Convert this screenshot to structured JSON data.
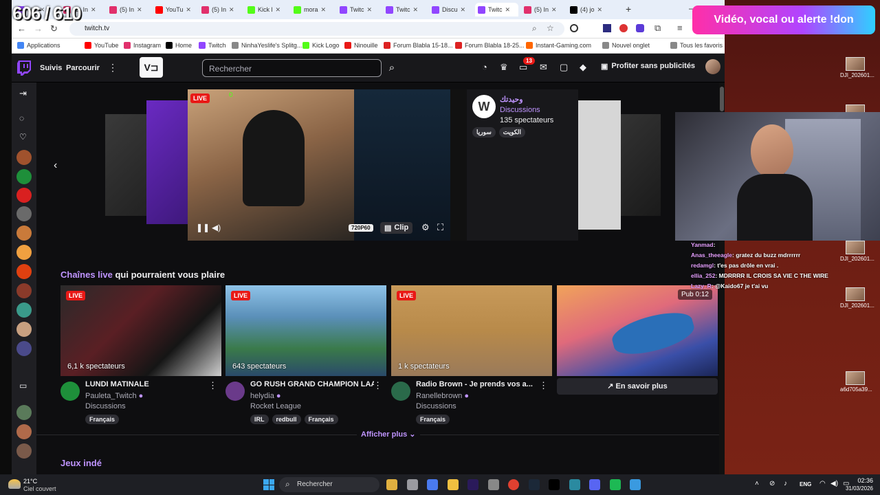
{
  "overlay": {
    "counter": "606 / 610",
    "donation": "Vidéo, vocal ou alerte !don",
    "chat": [
      {
        "user": "Yanmad",
        "text": ""
      },
      {
        "user": "Anas_theeagle",
        "text": "gratez du buzz mdrrrrrr"
      },
      {
        "user": "redamgl",
        "text": "t'es pas drôle en vrai ."
      },
      {
        "user": "ellia_252",
        "text": "MDRRRR IL CROIS SA VIE C THE WIRE"
      },
      {
        "user": "Lazy_R",
        "text": "@Kaido67 je t'ai vu"
      }
    ],
    "desktop_files": [
      "DJI_202601...",
      "DJI_202601...",
      "DJI_202601...",
      "DJI_202601...",
      "a6d705a39..."
    ]
  },
  "browser": {
    "tabs": [
      {
        "label": "Nin",
        "color": "#9146ff"
      },
      {
        "label": "(5) In",
        "color": "#e1306c"
      },
      {
        "label": "(5) In",
        "color": "#e1306c"
      },
      {
        "label": "YouTu",
        "color": "#ff0000"
      },
      {
        "label": "(5) In",
        "color": "#e1306c"
      },
      {
        "label": "Kick l",
        "color": "#53fc18"
      },
      {
        "label": "mora",
        "color": "#53fc18"
      },
      {
        "label": "Twitc",
        "color": "#9146ff"
      },
      {
        "label": "Twitc",
        "color": "#9146ff"
      },
      {
        "label": "Discu",
        "color": "#9146ff"
      },
      {
        "label": "Twitc",
        "color": "#9146ff"
      },
      {
        "label": "(5) In",
        "color": "#e1306c"
      },
      {
        "label": "(4) jo",
        "color": "#000000"
      }
    ],
    "url": "twitch.tv",
    "bookmarks": [
      {
        "label": "Applications",
        "color": "#4285f4"
      },
      {
        "label": "YouTube",
        "color": "#ff0000"
      },
      {
        "label": "Instagram",
        "color": "#e1306c"
      },
      {
        "label": "Home",
        "color": "#000000"
      },
      {
        "label": "Twitch",
        "color": "#9146ff"
      },
      {
        "label": "NinhaYeslife's Splitg...",
        "color": "#888888"
      },
      {
        "label": "Kick Logo",
        "color": "#53fc18"
      },
      {
        "label": "Ninouille",
        "color": "#e91916"
      },
      {
        "label": "Forum Blabla 15-18...",
        "color": "#d22"
      },
      {
        "label": "Forum Blabla 18-25...",
        "color": "#d22"
      },
      {
        "label": "Instant-Gaming.com",
        "color": "#f60"
      },
      {
        "label": "Nouvel onglet",
        "color": "#888"
      },
      {
        "label": "Tous les favoris",
        "color": "#888"
      }
    ]
  },
  "twitch": {
    "nav": {
      "following": "Suivis",
      "browse": "Parcourir",
      "search_placeholder": "Rechercher",
      "notif_count": "13",
      "prime": "Profiter sans publicités"
    },
    "featured": {
      "live": "LIVE",
      "viewers_icon_count": "0",
      "channel": "وحيدتك",
      "category": "Discussions",
      "viewers": "135 spectateurs",
      "tags": [
        "سوريا",
        "الكويت"
      ],
      "quality": "720P60",
      "clip": "Clip"
    },
    "section": {
      "highlight": "Chaînes live",
      "rest": " qui pourraient vous plaire"
    },
    "cards": [
      {
        "live": "LIVE",
        "viewers": "6,1 k spectateurs",
        "title": "LUNDI MATINALE",
        "channel": "Pauleta_Twitch",
        "category": "Discussions",
        "tags": [
          "Français"
        ]
      },
      {
        "live": "LIVE",
        "viewers": "643 spectateurs",
        "title": "GO RUSH GRAND CHAMPION LAA...",
        "channel": "helydia",
        "category": "Rocket League",
        "tags": [
          "IRL",
          "redbull",
          "Français"
        ]
      },
      {
        "live": "LIVE",
        "viewers": "1 k spectateurs",
        "title": "Radio Brown - Je prends vos a...",
        "channel": "Ranellebrown",
        "category": "Discussions",
        "tags": [
          "Français"
        ]
      }
    ],
    "ad": {
      "timer": "Pub 0:12",
      "cta": "En savoir plus"
    },
    "show_more": "Afficher plus",
    "next_section": "Jeux indé"
  },
  "taskbar": {
    "weather_temp": "21°C",
    "weather_desc": "Ciel couvert",
    "search": "Rechercher",
    "lang": "ENG",
    "time": "02:36",
    "date": "31/03/2026"
  }
}
